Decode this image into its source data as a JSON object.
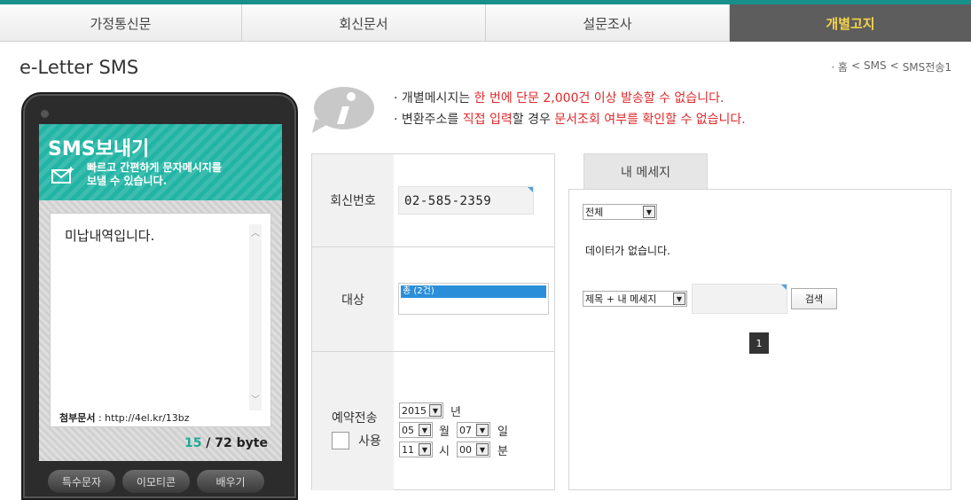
{
  "nav": {
    "tabs": [
      {
        "label": "가정통신문"
      },
      {
        "label": "회신문서"
      },
      {
        "label": "설문조사"
      },
      {
        "label": "개별고지"
      }
    ]
  },
  "page": {
    "title": "e-Letter SMS"
  },
  "breadcrumb": {
    "home": "· 홈",
    "sep": "<",
    "level1": "SMS",
    "level2": "SMS전송1"
  },
  "phone": {
    "title": "SMS보내기",
    "desc_line1": "빠르고 간편하게 문자메시지를",
    "desc_line2": "보낼 수 있습니다.",
    "message": "미납내역입니다.",
    "attach_label": "첨부문서",
    "attach_url": " : http://4el.kr/13bz",
    "byte_count": "15",
    "byte_total": " / 72 byte",
    "buttons": [
      "특수문자",
      "이모티콘",
      "배우기"
    ]
  },
  "info": {
    "line1": {
      "p1": "· 개별메시지는 ",
      "r1": "한 번에 단문 2,000건 이상 발송할 수 없습니다."
    },
    "line2": {
      "p1": "· 변환주소를 ",
      "r1": "직접 입력",
      "p2": "할 경우 ",
      "r2": "문서조회 여부를 확인할 수 없습니다."
    }
  },
  "form": {
    "reply_label": "회신번호",
    "reply_value": "02-585-2359",
    "target_label": "대상",
    "target_option": "총 (2건)",
    "reserve_label": "예약전송",
    "use_label": "사용",
    "year": "2015",
    "year_unit": "년",
    "month": "05",
    "month_unit": "월",
    "day": "07",
    "day_unit": "일",
    "hour": "11",
    "hour_unit": "시",
    "minute": "00",
    "minute_unit": "분"
  },
  "my": {
    "tab_label": "내 메세지",
    "filter": "전체",
    "no_data": "데이터가 없습니다.",
    "search_scope": "제목 + 내 메세지",
    "search_button": "검색",
    "page": "1"
  },
  "colors": {
    "accent": "#22b4a4",
    "warning": "#e0292b",
    "nav_active_text": "#f5d34a"
  }
}
